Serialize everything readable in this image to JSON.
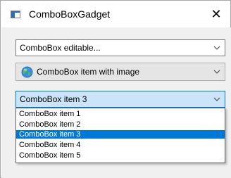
{
  "window": {
    "title": "ComboBoxGadget",
    "close_glyph": "✕"
  },
  "combo_editable": {
    "value": "ComboBox editable...",
    "arrow_icon": "chevron-down-icon"
  },
  "combo_image": {
    "value": "ComboBox item with image",
    "image_icon": "globe-icon",
    "arrow_icon": "chevron-down-icon"
  },
  "combo_list": {
    "value": "ComboBox item 3",
    "arrow_icon": "chevron-down-icon",
    "items": [
      "ComboBox item 1",
      "ComboBox item 2",
      "ComboBox item 3",
      "ComboBox item 4",
      "ComboBox item 5"
    ],
    "selected_index": 2
  },
  "colors": {
    "selection": "#0078d7",
    "focused_combo_bg": "#cce4f7",
    "client_bg": "#f0f0f0"
  }
}
